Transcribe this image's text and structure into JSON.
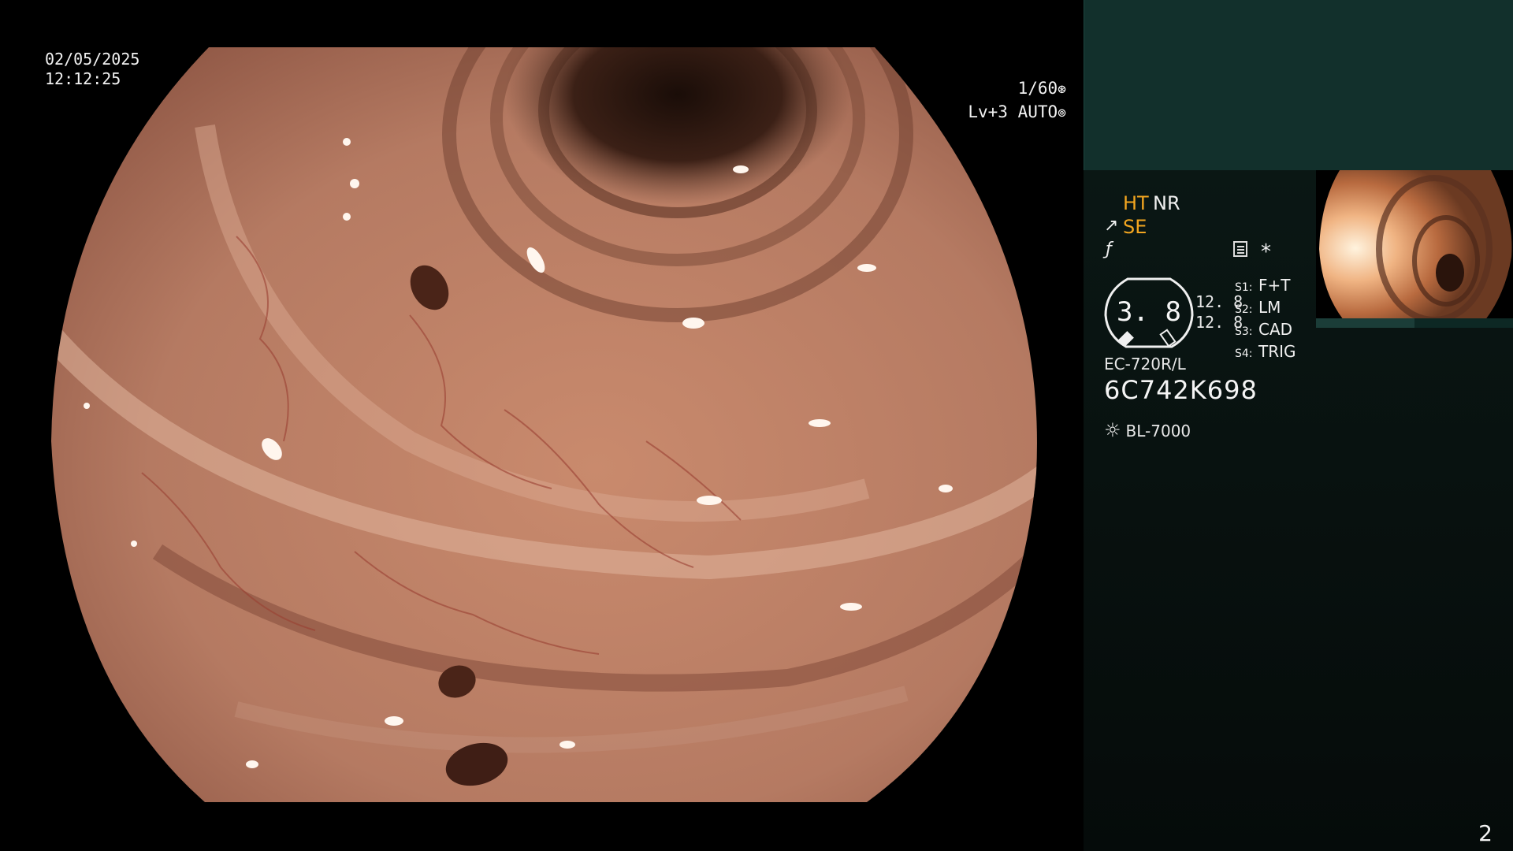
{
  "overlay": {
    "date": "02/05/2025",
    "time": "12:12:25",
    "shutter": "1/60",
    "shutter_icon": "aperture-icon",
    "level": "Lv+3 AUTO",
    "level_icon": "iris-icon"
  },
  "panel": {
    "mode_ht": "HT",
    "mode_nr": "NR",
    "mode_se": "SE",
    "se_icon": "scope-tip-icon",
    "f_icon": "filter-icon",
    "menu_icon": "memo-icon",
    "asterisk": "*",
    "dial_value": "3. 8",
    "reading_1": "12. 8",
    "reading_2": "12. 8",
    "switches": [
      {
        "key": "S1:",
        "value": "F+T"
      },
      {
        "key": "S2:",
        "value": "LM"
      },
      {
        "key": "S3:",
        "value": "CAD"
      },
      {
        "key": "S4:",
        "value": "TRIG"
      }
    ],
    "scope_model": "EC-720R/L",
    "scope_serial": "6C742K698",
    "light_icon": "sun-icon",
    "light_source": "BL-7000"
  },
  "page_number": "2",
  "colors": {
    "accent_amber": "#f2a520",
    "panel_top": "#12302c",
    "panel_bg": "#08110f"
  }
}
